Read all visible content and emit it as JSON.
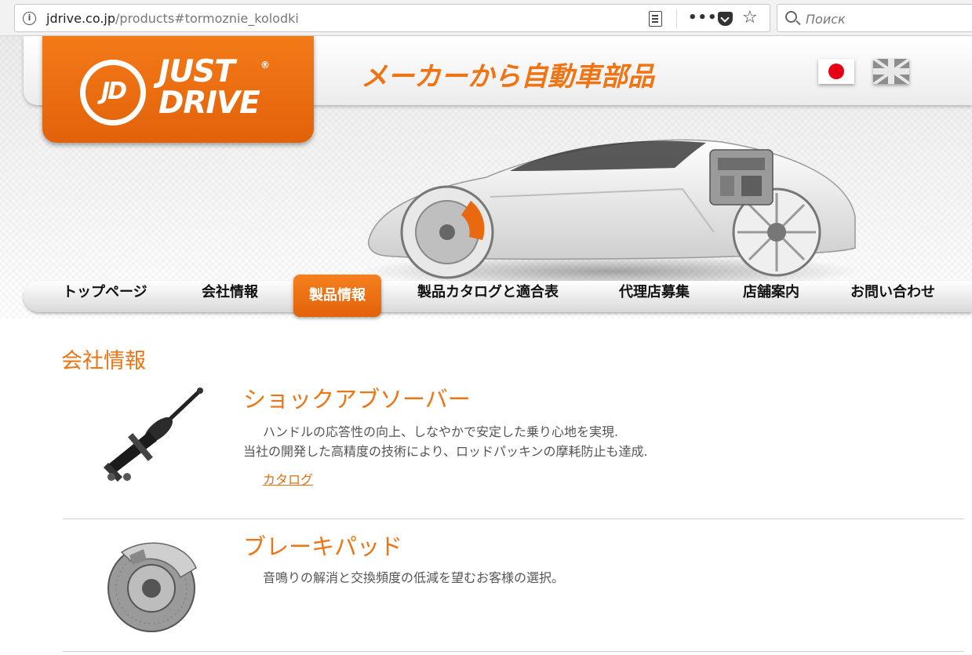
{
  "browser": {
    "url_domain": "jdrive.co.jp",
    "url_path": "/products#tormoznie_kolodki",
    "search_placeholder": "Поиск",
    "more_label": "•••"
  },
  "header": {
    "logo_badge": "JD",
    "logo_line1": "JUST",
    "logo_line2": "DRIVE",
    "logo_registered": "®",
    "tagline": "メーカーから自動車部品",
    "languages": [
      "日本語",
      "English"
    ]
  },
  "nav": {
    "items": [
      {
        "label": "トップページ",
        "active": false
      },
      {
        "label": "会社情報",
        "active": false
      },
      {
        "label": "製品情報",
        "active": true
      },
      {
        "label": "製品カタログと適合表",
        "active": false
      },
      {
        "label": "代理店募集",
        "active": false
      },
      {
        "label": "店舗案内",
        "active": false
      },
      {
        "label": "お問い合わせ",
        "active": false
      }
    ]
  },
  "content": {
    "section_title": "会社情報",
    "products": [
      {
        "title": "ショックアブソーバー",
        "desc_line1": "ハンドルの応答性の向上、しなやかで安定した乗り心地を実現.",
        "desc_line2": "当社の開発した高精度の技術により、ロッドパッキンの摩耗防止も達成.",
        "link": "カタログ",
        "icon": "shock-absorber"
      },
      {
        "title": "ブレーキパッド",
        "desc_line1": "音鳴りの解消と交換頻度の低減を望むお客様の選択。",
        "icon": "brake-disc"
      }
    ]
  },
  "colors": {
    "accent": "#ee7414",
    "nav_active": "#e8690f",
    "text": "#555555"
  }
}
